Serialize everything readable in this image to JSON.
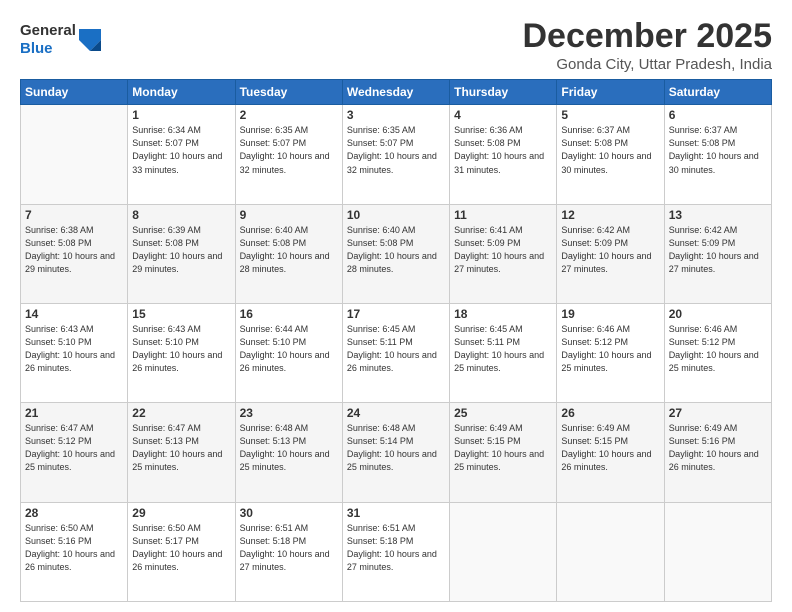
{
  "header": {
    "logo_line1": "General",
    "logo_line2": "Blue",
    "month": "December 2025",
    "location": "Gonda City, Uttar Pradesh, India"
  },
  "weekdays": [
    "Sunday",
    "Monday",
    "Tuesday",
    "Wednesday",
    "Thursday",
    "Friday",
    "Saturday"
  ],
  "weeks": [
    [
      {
        "day": "",
        "sunrise": "",
        "sunset": "",
        "daylight": ""
      },
      {
        "day": "1",
        "sunrise": "Sunrise: 6:34 AM",
        "sunset": "Sunset: 5:07 PM",
        "daylight": "Daylight: 10 hours and 33 minutes."
      },
      {
        "day": "2",
        "sunrise": "Sunrise: 6:35 AM",
        "sunset": "Sunset: 5:07 PM",
        "daylight": "Daylight: 10 hours and 32 minutes."
      },
      {
        "day": "3",
        "sunrise": "Sunrise: 6:35 AM",
        "sunset": "Sunset: 5:07 PM",
        "daylight": "Daylight: 10 hours and 32 minutes."
      },
      {
        "day": "4",
        "sunrise": "Sunrise: 6:36 AM",
        "sunset": "Sunset: 5:08 PM",
        "daylight": "Daylight: 10 hours and 31 minutes."
      },
      {
        "day": "5",
        "sunrise": "Sunrise: 6:37 AM",
        "sunset": "Sunset: 5:08 PM",
        "daylight": "Daylight: 10 hours and 30 minutes."
      },
      {
        "day": "6",
        "sunrise": "Sunrise: 6:37 AM",
        "sunset": "Sunset: 5:08 PM",
        "daylight": "Daylight: 10 hours and 30 minutes."
      }
    ],
    [
      {
        "day": "7",
        "sunrise": "Sunrise: 6:38 AM",
        "sunset": "Sunset: 5:08 PM",
        "daylight": "Daylight: 10 hours and 29 minutes."
      },
      {
        "day": "8",
        "sunrise": "Sunrise: 6:39 AM",
        "sunset": "Sunset: 5:08 PM",
        "daylight": "Daylight: 10 hours and 29 minutes."
      },
      {
        "day": "9",
        "sunrise": "Sunrise: 6:40 AM",
        "sunset": "Sunset: 5:08 PM",
        "daylight": "Daylight: 10 hours and 28 minutes."
      },
      {
        "day": "10",
        "sunrise": "Sunrise: 6:40 AM",
        "sunset": "Sunset: 5:08 PM",
        "daylight": "Daylight: 10 hours and 28 minutes."
      },
      {
        "day": "11",
        "sunrise": "Sunrise: 6:41 AM",
        "sunset": "Sunset: 5:09 PM",
        "daylight": "Daylight: 10 hours and 27 minutes."
      },
      {
        "day": "12",
        "sunrise": "Sunrise: 6:42 AM",
        "sunset": "Sunset: 5:09 PM",
        "daylight": "Daylight: 10 hours and 27 minutes."
      },
      {
        "day": "13",
        "sunrise": "Sunrise: 6:42 AM",
        "sunset": "Sunset: 5:09 PM",
        "daylight": "Daylight: 10 hours and 27 minutes."
      }
    ],
    [
      {
        "day": "14",
        "sunrise": "Sunrise: 6:43 AM",
        "sunset": "Sunset: 5:10 PM",
        "daylight": "Daylight: 10 hours and 26 minutes."
      },
      {
        "day": "15",
        "sunrise": "Sunrise: 6:43 AM",
        "sunset": "Sunset: 5:10 PM",
        "daylight": "Daylight: 10 hours and 26 minutes."
      },
      {
        "day": "16",
        "sunrise": "Sunrise: 6:44 AM",
        "sunset": "Sunset: 5:10 PM",
        "daylight": "Daylight: 10 hours and 26 minutes."
      },
      {
        "day": "17",
        "sunrise": "Sunrise: 6:45 AM",
        "sunset": "Sunset: 5:11 PM",
        "daylight": "Daylight: 10 hours and 26 minutes."
      },
      {
        "day": "18",
        "sunrise": "Sunrise: 6:45 AM",
        "sunset": "Sunset: 5:11 PM",
        "daylight": "Daylight: 10 hours and 25 minutes."
      },
      {
        "day": "19",
        "sunrise": "Sunrise: 6:46 AM",
        "sunset": "Sunset: 5:12 PM",
        "daylight": "Daylight: 10 hours and 25 minutes."
      },
      {
        "day": "20",
        "sunrise": "Sunrise: 6:46 AM",
        "sunset": "Sunset: 5:12 PM",
        "daylight": "Daylight: 10 hours and 25 minutes."
      }
    ],
    [
      {
        "day": "21",
        "sunrise": "Sunrise: 6:47 AM",
        "sunset": "Sunset: 5:12 PM",
        "daylight": "Daylight: 10 hours and 25 minutes."
      },
      {
        "day": "22",
        "sunrise": "Sunrise: 6:47 AM",
        "sunset": "Sunset: 5:13 PM",
        "daylight": "Daylight: 10 hours and 25 minutes."
      },
      {
        "day": "23",
        "sunrise": "Sunrise: 6:48 AM",
        "sunset": "Sunset: 5:13 PM",
        "daylight": "Daylight: 10 hours and 25 minutes."
      },
      {
        "day": "24",
        "sunrise": "Sunrise: 6:48 AM",
        "sunset": "Sunset: 5:14 PM",
        "daylight": "Daylight: 10 hours and 25 minutes."
      },
      {
        "day": "25",
        "sunrise": "Sunrise: 6:49 AM",
        "sunset": "Sunset: 5:15 PM",
        "daylight": "Daylight: 10 hours and 25 minutes."
      },
      {
        "day": "26",
        "sunrise": "Sunrise: 6:49 AM",
        "sunset": "Sunset: 5:15 PM",
        "daylight": "Daylight: 10 hours and 26 minutes."
      },
      {
        "day": "27",
        "sunrise": "Sunrise: 6:49 AM",
        "sunset": "Sunset: 5:16 PM",
        "daylight": "Daylight: 10 hours and 26 minutes."
      }
    ],
    [
      {
        "day": "28",
        "sunrise": "Sunrise: 6:50 AM",
        "sunset": "Sunset: 5:16 PM",
        "daylight": "Daylight: 10 hours and 26 minutes."
      },
      {
        "day": "29",
        "sunrise": "Sunrise: 6:50 AM",
        "sunset": "Sunset: 5:17 PM",
        "daylight": "Daylight: 10 hours and 26 minutes."
      },
      {
        "day": "30",
        "sunrise": "Sunrise: 6:51 AM",
        "sunset": "Sunset: 5:18 PM",
        "daylight": "Daylight: 10 hours and 27 minutes."
      },
      {
        "day": "31",
        "sunrise": "Sunrise: 6:51 AM",
        "sunset": "Sunset: 5:18 PM",
        "daylight": "Daylight: 10 hours and 27 minutes."
      },
      {
        "day": "",
        "sunrise": "",
        "sunset": "",
        "daylight": ""
      },
      {
        "day": "",
        "sunrise": "",
        "sunset": "",
        "daylight": ""
      },
      {
        "day": "",
        "sunrise": "",
        "sunset": "",
        "daylight": ""
      }
    ]
  ]
}
